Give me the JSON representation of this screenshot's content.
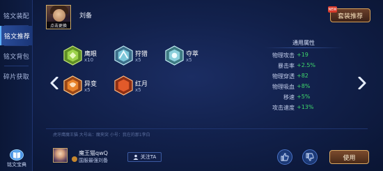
{
  "sidebar": {
    "items": [
      {
        "label": "铭文装配"
      },
      {
        "label": "铭文推荐"
      },
      {
        "label": "铭文背包"
      },
      {
        "label": "碎片获取"
      }
    ],
    "dictionary_label": "铭文宝典"
  },
  "hero": {
    "name": "刘备",
    "change_label": "点击更换"
  },
  "suit_button": {
    "label": "套装推荐",
    "badge": "NEW"
  },
  "runes": [
    {
      "name": "鹰眼",
      "count": "x10",
      "color": "#8ec63f"
    },
    {
      "name": "狩猎",
      "count": "x5",
      "color": "#7cc7d9"
    },
    {
      "name": "夺萃",
      "count": "x5",
      "color": "#8cd0dc"
    },
    {
      "name": "异变",
      "count": "x5",
      "color": "#e8822a"
    },
    {
      "name": "红月",
      "count": "x5",
      "color": "#e15a2a"
    }
  ],
  "attributes": {
    "title": "通用属性",
    "rows": [
      {
        "name": "物理攻击",
        "value": "+19"
      },
      {
        "name": "暴击率",
        "value": "+2.5%"
      },
      {
        "name": "物理穿透",
        "value": "+82"
      },
      {
        "name": "物理吸血",
        "value": "+8%"
      },
      {
        "name": "移速",
        "value": "+5%"
      },
      {
        "name": "攻击速度",
        "value": "+13%"
      }
    ]
  },
  "note": "虎牙鹰魔王猫  大号出：魔夹突  小号：我在的那1李白",
  "author": {
    "name": "魔王猫qwQ",
    "title": "国服最强刘备",
    "follow_label": "关注TA"
  },
  "use_button": {
    "label": "使用"
  }
}
